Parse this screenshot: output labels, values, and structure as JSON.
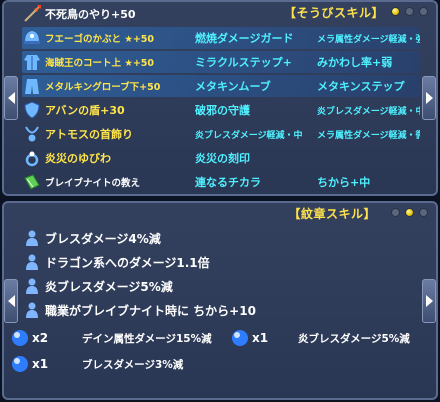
{
  "equip_panel": {
    "title": "【そうびスキル】",
    "rows": [
      {
        "name": "不死鳥のやり",
        "plus": "+50",
        "skill1": "",
        "skill2": "",
        "icon": "spear-icon"
      },
      {
        "name": "フエーゴのかぶと",
        "plus": "★+50",
        "skill1": "燃焼ダメージガード",
        "skill2": "メラ属性ダメージ軽減・強",
        "icon": "helmet-icon"
      },
      {
        "name": "海賊王のコート上",
        "plus": "★+50",
        "skill1": "ミラクルステップ+",
        "skill2": "みかわし率+弱",
        "icon": "coat-top-icon"
      },
      {
        "name": "メタルキングローブ下",
        "plus": "+50",
        "skill1": "メタキンムーブ",
        "skill2": "メタキンステップ",
        "icon": "robe-bottom-icon"
      },
      {
        "name": "アバンの盾",
        "plus": "+30",
        "skill1": "破邪の守護",
        "skill2": "炎ブレスダメージ軽減・中",
        "icon": "shield-icon"
      },
      {
        "name": "アトモスの首飾り",
        "plus": "",
        "skill1": "炎ブレスダメージ軽減・中",
        "skill2": "メラ属性ダメージ軽減・微弱",
        "icon": "necklace-icon"
      },
      {
        "name": "炎災のゆびわ",
        "plus": "",
        "skill1": "炎災の刻印",
        "skill2": "",
        "icon": "ring-icon"
      },
      {
        "name": "ブレイブナイトの教え",
        "plus": "",
        "skill1": "連なるチカラ",
        "skill2": "ちから+中",
        "icon": "book-icon"
      }
    ]
  },
  "crest_panel": {
    "title": "【紋章スキル】",
    "rows": [
      "ブレスダメージ4%減",
      "ドラゴン系へのダメージ1.1倍",
      "炎ブレスダメージ5%減",
      "職業がブレイブナイト時に ちから+10"
    ],
    "orbs": [
      {
        "count": "x2",
        "text": "デイン属性ダメージ15%減"
      },
      {
        "count": "x1",
        "text": "炎ブレスダメージ5%減"
      },
      {
        "count": "x1",
        "text": "ブレスダメージ3%減"
      }
    ]
  },
  "colors": {
    "name_yellow": "#ffe54a",
    "skill_cyan": "#4ff0ff",
    "highlight_blue": "#2e78c8"
  }
}
